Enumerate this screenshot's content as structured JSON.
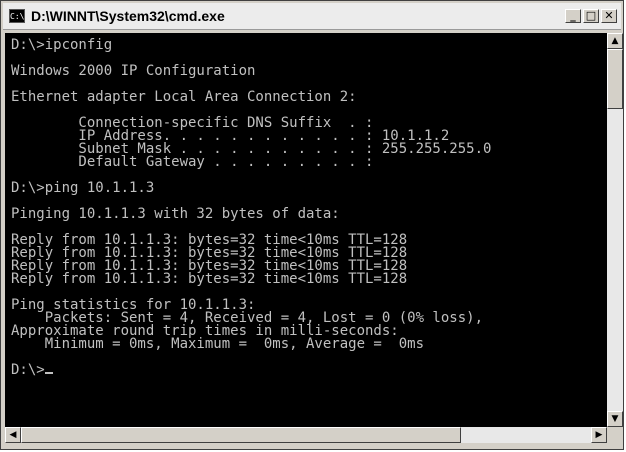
{
  "window": {
    "title": "D:\\WINNT\\System32\\cmd.exe",
    "icon_text": "C:\\",
    "buttons": {
      "minimize": "_",
      "maximize": "□",
      "close": "✕"
    }
  },
  "console": {
    "lines": [
      "D:\\>ipconfig",
      "",
      "Windows 2000 IP Configuration",
      "",
      "Ethernet adapter Local Area Connection 2:",
      "",
      "        Connection-specific DNS Suffix  . :",
      "        IP Address. . . . . . . . . . . . : 10.1.1.2",
      "        Subnet Mask . . . . . . . . . . . : 255.255.255.0",
      "        Default Gateway . . . . . . . . . :",
      "",
      "D:\\>ping 10.1.1.3",
      "",
      "Pinging 10.1.1.3 with 32 bytes of data:",
      "",
      "Reply from 10.1.1.3: bytes=32 time<10ms TTL=128",
      "Reply from 10.1.1.3: bytes=32 time<10ms TTL=128",
      "Reply from 10.1.1.3: bytes=32 time<10ms TTL=128",
      "Reply from 10.1.1.3: bytes=32 time<10ms TTL=128",
      "",
      "Ping statistics for 10.1.1.3:",
      "    Packets: Sent = 4, Received = 4, Lost = 0 (0% loss),",
      "Approximate round trip times in milli-seconds:",
      "    Minimum = 0ms, Maximum =  0ms, Average =  0ms",
      "",
      "D:\\>"
    ]
  },
  "scrollbars": {
    "up": "▲",
    "down": "▼",
    "left": "◀",
    "right": "▶"
  },
  "colors": {
    "console_bg": "#000000",
    "console_fg": "#c0c0c0",
    "chrome": "#d4d0c8"
  }
}
